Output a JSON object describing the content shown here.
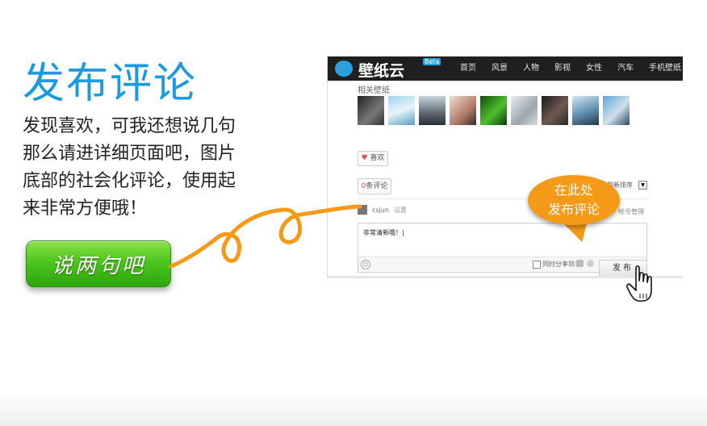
{
  "promo": {
    "title": "发布评论",
    "lines": [
      "发现喜欢，可我还想说几句",
      "那么请进详细页面吧，图片",
      "底部的社会化评论，使用起",
      "来非常方便哦！"
    ],
    "cta_label": "说两句吧"
  },
  "screenshot": {
    "logo_text": "壁纸云",
    "logo_badge": "Beta",
    "nav": [
      "首页",
      "风景",
      "人物",
      "影视",
      "女性",
      "汽车",
      "手机壁纸"
    ],
    "related_label": "相关壁纸",
    "like_label": "喜欢",
    "comment_count_num": "0",
    "comment_count_label": "条评论",
    "sort_label": "按到新排序",
    "username": "csjun",
    "user_settings": "设置",
    "account_manage": "帐号管理",
    "comment_text": "非常清新哦！|",
    "share_label": "同时分享到：",
    "publish_label": "发布"
  },
  "bubble": {
    "line1": "在此处",
    "line2": "发布评论"
  },
  "colors": {
    "title_blue": "#1a9ae0",
    "cta_green": "#4cc61e",
    "bubble_orange": "#f59a17",
    "nav_dark": "#1f1f1f"
  }
}
